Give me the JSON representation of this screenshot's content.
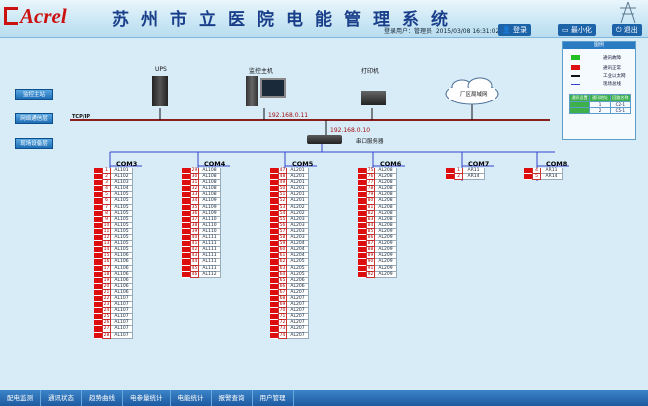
{
  "header": {
    "logo": "Acrel",
    "title": "苏州市立医院电能管理系统",
    "user": "登录用户：管理员",
    "datetime": "2015/03/08 16:31:02.6",
    "buttons": [
      "登录",
      "最小化",
      "退出"
    ]
  },
  "sidebar": {
    "items": [
      "监控主站",
      "网络通信层",
      "现场设备层"
    ]
  },
  "legend": {
    "title": "图例",
    "items": [
      {
        "label": "通讯故障",
        "color": "#22c022"
      },
      {
        "label": "通讯正常",
        "color": "#dd1111"
      },
      {
        "label": "工业以太网",
        "color": "#111111"
      },
      {
        "label": "现场总线",
        "color": "#3344cc"
      }
    ],
    "table": {
      "headers": [
        "通讯设置",
        "通讯地址",
        "回路名称"
      ],
      "rows": [
        [
          "",
          "1",
          "C2-1"
        ],
        [
          "",
          "2",
          "C5-1"
        ]
      ]
    }
  },
  "network": {
    "ups": "UPS",
    "host": "监控主机",
    "printer": "打印机",
    "lan": "厂区局域网",
    "protocol": "TCP/IP",
    "host_ip": "192.168.0.11",
    "server_ip": "192.168.0.10",
    "server": "串口服务器"
  },
  "coms": [
    {
      "name": "COM3",
      "rows": [
        [
          "1",
          "AL101"
        ],
        [
          "2",
          "AL102"
        ],
        [
          "3",
          "AL103"
        ],
        [
          "4",
          "AL104"
        ],
        [
          "5",
          "AL105"
        ],
        [
          "6",
          "AL105"
        ],
        [
          "7",
          "AL105"
        ],
        [
          "8",
          "AL105"
        ],
        [
          "9",
          "AL105"
        ],
        [
          "10",
          "AL105"
        ],
        [
          "11",
          "AL105"
        ],
        [
          "12",
          "AL105"
        ],
        [
          "13",
          "AL105"
        ],
        [
          "14",
          "AL105"
        ],
        [
          "15",
          "AL106"
        ],
        [
          "16",
          "AL106"
        ],
        [
          "17",
          "AL106"
        ],
        [
          "18",
          "AL106"
        ],
        [
          "19",
          "AL106"
        ],
        [
          "20",
          "AL106"
        ],
        [
          "21",
          "AL106"
        ],
        [
          "22",
          "AL107"
        ],
        [
          "23",
          "AL107"
        ],
        [
          "24",
          "AL107"
        ],
        [
          "25",
          "AL107"
        ],
        [
          "26",
          "AL107"
        ],
        [
          "27",
          "AL107"
        ],
        [
          "28",
          "AL107"
        ]
      ]
    },
    {
      "name": "COM4",
      "rows": [
        [
          "29",
          "AL108"
        ],
        [
          "30",
          "AL108"
        ],
        [
          "31",
          "AL108"
        ],
        [
          "32",
          "AL108"
        ],
        [
          "33",
          "AL108"
        ],
        [
          "34",
          "AL109"
        ],
        [
          "35",
          "AL109"
        ],
        [
          "36",
          "AL109"
        ],
        [
          "37",
          "AL110"
        ],
        [
          "38",
          "AL110"
        ],
        [
          "39",
          "AL110"
        ],
        [
          "40",
          "AL111"
        ],
        [
          "41",
          "AL111"
        ],
        [
          "42",
          "AL111"
        ],
        [
          "43",
          "AL111"
        ],
        [
          "44",
          "AL111"
        ],
        [
          "45",
          "AL111"
        ],
        [
          "46",
          "AL112"
        ]
      ]
    },
    {
      "name": "COM5",
      "rows": [
        [
          "47",
          "AL201"
        ],
        [
          "48",
          "AL201"
        ],
        [
          "49",
          "AL201"
        ],
        [
          "50",
          "AL201"
        ],
        [
          "51",
          "AL201"
        ],
        [
          "52",
          "AL201"
        ],
        [
          "53",
          "AL202"
        ],
        [
          "54",
          "AL202"
        ],
        [
          "55",
          "AL203"
        ],
        [
          "56",
          "AL203"
        ],
        [
          "57",
          "AL203"
        ],
        [
          "58",
          "AL203"
        ],
        [
          "59",
          "AL204"
        ],
        [
          "60",
          "AL204"
        ],
        [
          "61",
          "AL204"
        ],
        [
          "62",
          "AL205"
        ],
        [
          "63",
          "AL205"
        ],
        [
          "64",
          "AL205"
        ],
        [
          "65",
          "AL206"
        ],
        [
          "66",
          "AL206"
        ],
        [
          "67",
          "AL207"
        ],
        [
          "68",
          "AL207"
        ],
        [
          "69",
          "AL207"
        ],
        [
          "70",
          "AL207"
        ],
        [
          "71",
          "AL207"
        ],
        [
          "72",
          "AL207"
        ],
        [
          "73",
          "AL207"
        ],
        [
          "74",
          "AL207"
        ]
      ]
    },
    {
      "name": "COM6",
      "rows": [
        [
          "75",
          "AL208"
        ],
        [
          "76",
          "AL208"
        ],
        [
          "77",
          "AL208"
        ],
        [
          "78",
          "AL208"
        ],
        [
          "79",
          "AL208"
        ],
        [
          "80",
          "AL208"
        ],
        [
          "81",
          "AL208"
        ],
        [
          "82",
          "AL208"
        ],
        [
          "83",
          "AL208"
        ],
        [
          "84",
          "AL208"
        ],
        [
          "85",
          "AL209"
        ],
        [
          "86",
          "AL209"
        ],
        [
          "87",
          "AL209"
        ],
        [
          "88",
          "AL209"
        ],
        [
          "89",
          "AL209"
        ],
        [
          "90",
          "AL209"
        ],
        [
          "91",
          "AL209"
        ],
        [
          "92",
          "AL209"
        ]
      ]
    },
    {
      "name": "COM7",
      "rows": [
        [
          "1",
          "AR11"
        ],
        [
          "2",
          "AR14"
        ]
      ]
    },
    {
      "name": "COM8",
      "rows": [
        [
          "4",
          "AR11"
        ],
        [
          "5",
          "AR14"
        ]
      ]
    }
  ],
  "bottom": {
    "tabs": [
      "配电监测",
      "通讯状态",
      "趋势曲线",
      "电参量统计",
      "电能统计",
      "报警查询",
      "用户管理"
    ]
  }
}
